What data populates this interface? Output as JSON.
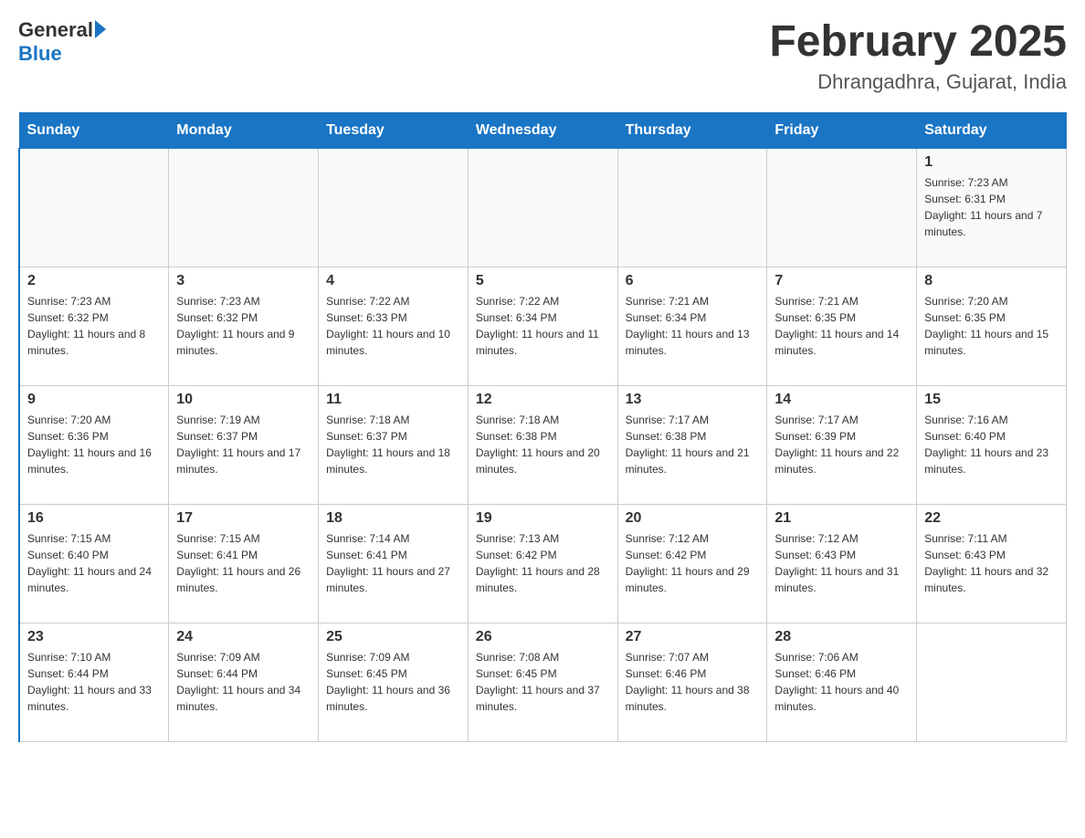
{
  "header": {
    "logo_general": "General",
    "logo_blue": "Blue",
    "title": "February 2025",
    "subtitle": "Dhrangadhra, Gujarat, India"
  },
  "days_of_week": [
    "Sunday",
    "Monday",
    "Tuesday",
    "Wednesday",
    "Thursday",
    "Friday",
    "Saturday"
  ],
  "weeks": [
    [
      {
        "day": "",
        "info": ""
      },
      {
        "day": "",
        "info": ""
      },
      {
        "day": "",
        "info": ""
      },
      {
        "day": "",
        "info": ""
      },
      {
        "day": "",
        "info": ""
      },
      {
        "day": "",
        "info": ""
      },
      {
        "day": "1",
        "info": "Sunrise: 7:23 AM\nSunset: 6:31 PM\nDaylight: 11 hours and 7 minutes."
      }
    ],
    [
      {
        "day": "2",
        "info": "Sunrise: 7:23 AM\nSunset: 6:32 PM\nDaylight: 11 hours and 8 minutes."
      },
      {
        "day": "3",
        "info": "Sunrise: 7:23 AM\nSunset: 6:32 PM\nDaylight: 11 hours and 9 minutes."
      },
      {
        "day": "4",
        "info": "Sunrise: 7:22 AM\nSunset: 6:33 PM\nDaylight: 11 hours and 10 minutes."
      },
      {
        "day": "5",
        "info": "Sunrise: 7:22 AM\nSunset: 6:34 PM\nDaylight: 11 hours and 11 minutes."
      },
      {
        "day": "6",
        "info": "Sunrise: 7:21 AM\nSunset: 6:34 PM\nDaylight: 11 hours and 13 minutes."
      },
      {
        "day": "7",
        "info": "Sunrise: 7:21 AM\nSunset: 6:35 PM\nDaylight: 11 hours and 14 minutes."
      },
      {
        "day": "8",
        "info": "Sunrise: 7:20 AM\nSunset: 6:35 PM\nDaylight: 11 hours and 15 minutes."
      }
    ],
    [
      {
        "day": "9",
        "info": "Sunrise: 7:20 AM\nSunset: 6:36 PM\nDaylight: 11 hours and 16 minutes."
      },
      {
        "day": "10",
        "info": "Sunrise: 7:19 AM\nSunset: 6:37 PM\nDaylight: 11 hours and 17 minutes."
      },
      {
        "day": "11",
        "info": "Sunrise: 7:18 AM\nSunset: 6:37 PM\nDaylight: 11 hours and 18 minutes."
      },
      {
        "day": "12",
        "info": "Sunrise: 7:18 AM\nSunset: 6:38 PM\nDaylight: 11 hours and 20 minutes."
      },
      {
        "day": "13",
        "info": "Sunrise: 7:17 AM\nSunset: 6:38 PM\nDaylight: 11 hours and 21 minutes."
      },
      {
        "day": "14",
        "info": "Sunrise: 7:17 AM\nSunset: 6:39 PM\nDaylight: 11 hours and 22 minutes."
      },
      {
        "day": "15",
        "info": "Sunrise: 7:16 AM\nSunset: 6:40 PM\nDaylight: 11 hours and 23 minutes."
      }
    ],
    [
      {
        "day": "16",
        "info": "Sunrise: 7:15 AM\nSunset: 6:40 PM\nDaylight: 11 hours and 24 minutes."
      },
      {
        "day": "17",
        "info": "Sunrise: 7:15 AM\nSunset: 6:41 PM\nDaylight: 11 hours and 26 minutes."
      },
      {
        "day": "18",
        "info": "Sunrise: 7:14 AM\nSunset: 6:41 PM\nDaylight: 11 hours and 27 minutes."
      },
      {
        "day": "19",
        "info": "Sunrise: 7:13 AM\nSunset: 6:42 PM\nDaylight: 11 hours and 28 minutes."
      },
      {
        "day": "20",
        "info": "Sunrise: 7:12 AM\nSunset: 6:42 PM\nDaylight: 11 hours and 29 minutes."
      },
      {
        "day": "21",
        "info": "Sunrise: 7:12 AM\nSunset: 6:43 PM\nDaylight: 11 hours and 31 minutes."
      },
      {
        "day": "22",
        "info": "Sunrise: 7:11 AM\nSunset: 6:43 PM\nDaylight: 11 hours and 32 minutes."
      }
    ],
    [
      {
        "day": "23",
        "info": "Sunrise: 7:10 AM\nSunset: 6:44 PM\nDaylight: 11 hours and 33 minutes."
      },
      {
        "day": "24",
        "info": "Sunrise: 7:09 AM\nSunset: 6:44 PM\nDaylight: 11 hours and 34 minutes."
      },
      {
        "day": "25",
        "info": "Sunrise: 7:09 AM\nSunset: 6:45 PM\nDaylight: 11 hours and 36 minutes."
      },
      {
        "day": "26",
        "info": "Sunrise: 7:08 AM\nSunset: 6:45 PM\nDaylight: 11 hours and 37 minutes."
      },
      {
        "day": "27",
        "info": "Sunrise: 7:07 AM\nSunset: 6:46 PM\nDaylight: 11 hours and 38 minutes."
      },
      {
        "day": "28",
        "info": "Sunrise: 7:06 AM\nSunset: 6:46 PM\nDaylight: 11 hours and 40 minutes."
      },
      {
        "day": "",
        "info": ""
      }
    ]
  ]
}
